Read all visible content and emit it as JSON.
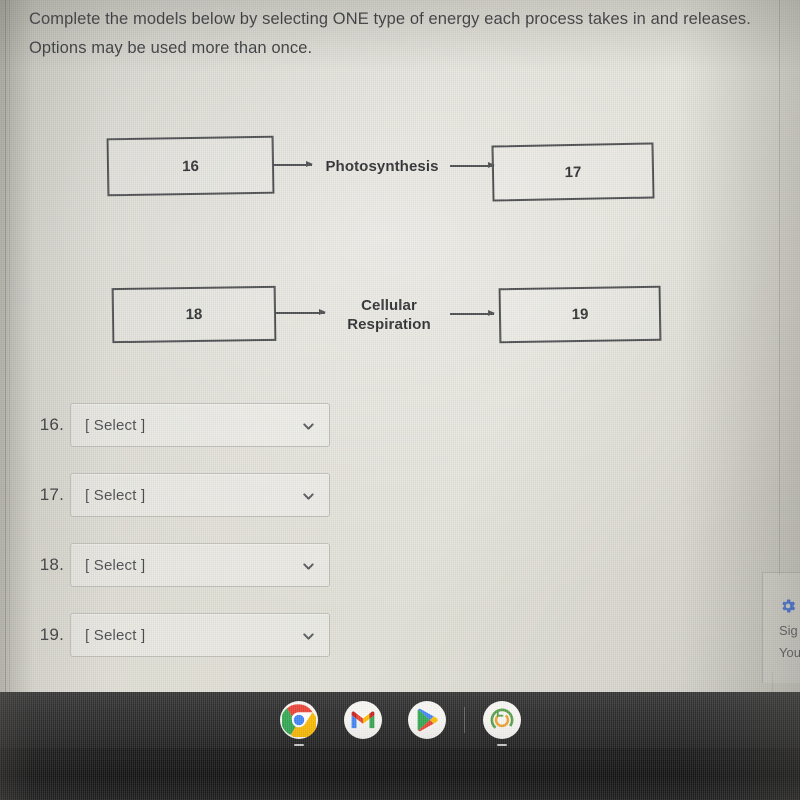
{
  "prompt": {
    "text": "Complete the models below by selecting ONE type of energy each process takes in and releases. Options may be used more than once."
  },
  "diagram": {
    "rows": [
      {
        "input_box": "16",
        "process": "Photosynthesis",
        "output_box": "17"
      },
      {
        "input_box": "18",
        "process": "Cellular Respiration",
        "process_line1": "Cellular",
        "process_line2": "Respiration",
        "output_box": "19"
      }
    ]
  },
  "selects": [
    {
      "number": "16.",
      "value": "[ Select ]"
    },
    {
      "number": "17.",
      "value": "[ Select ]"
    },
    {
      "number": "18.",
      "value": "[ Select ]"
    },
    {
      "number": "19.",
      "value": "[ Select ]"
    }
  ],
  "side_panel": {
    "gear_icon": "gear-icon",
    "line1": "Sig",
    "line2": "You"
  },
  "shelf": {
    "items": [
      {
        "name": "chrome",
        "label": "Google Chrome"
      },
      {
        "name": "gmail",
        "label": "Gmail"
      },
      {
        "name": "play-store",
        "label": "Play Store"
      },
      {
        "name": "clock",
        "label": "Clock"
      }
    ]
  },
  "colors": {
    "accent_blue": "#3f6fd8",
    "box_border": "#4c4d50",
    "text": "#3b3c40",
    "shelf_bg": "#2a2a2b"
  }
}
